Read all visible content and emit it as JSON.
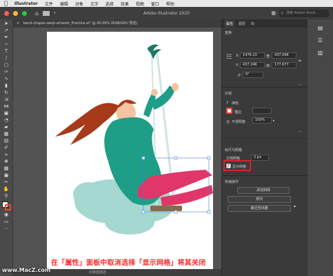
{
  "menubar": {
    "apple": "",
    "app": "Illustrator",
    "items": [
      "文件",
      "编辑",
      "对象",
      "文字",
      "选择",
      "效果",
      "视图",
      "窗口",
      "帮助"
    ]
  },
  "appbar": {
    "title": "Adobe Illustrator 2020",
    "search_placeholder": "搜索 Adobe Stock"
  },
  "document": {
    "tab_label": "bend-shapes-warp-artwork_Practice.ai* @ 45.08% (RGB/GPU 预览)",
    "close": "×"
  },
  "statusbar": {
    "text": "切换直接选"
  },
  "panel": {
    "tabs": [
      "属性",
      "图层",
      "库"
    ],
    "transform_title": "变换",
    "x_label": "X:",
    "x_value": "1476.23",
    "w_label": "宽:",
    "w_value": "437.096",
    "y_label": "Y:",
    "y_value": "437.246",
    "h_label": "高:",
    "h_value": "177.677",
    "angle_value": "0°",
    "appearance_title": "外观",
    "fill_label": "填色",
    "stroke_label": "描边",
    "stroke_value": "",
    "opacity_label": "不透明度",
    "opacity_value": "100%",
    "ruler_title": "标尺与网格",
    "grid_spacing_label": "文档网格",
    "grid_spacing_value": "2 px",
    "show_grid_label": "显示网格",
    "quick_actions_title": "快速操作",
    "btn_expand": "添加到库",
    "btn_arrange": "排列",
    "btn_path": "路径查找器",
    "more": "..."
  },
  "caption": "在「属性」面板中取消选择「显示网格」将其关闭",
  "watermark": "www.MacZ.com",
  "colors": {
    "hair": "#a63a1a",
    "sweater": "#1e9e86",
    "pants": "#e0366a",
    "cloud": "#a5d8d0",
    "bird": "#1a7a63",
    "highlight": "#e0202a"
  },
  "icons": {
    "tools": [
      "selection-tool-icon",
      "direct-selection-tool-icon",
      "pen-tool-icon",
      "curvature-tool-icon",
      "type-tool-icon",
      "line-tool-icon",
      "rectangle-tool-icon",
      "paintbrush-tool-icon",
      "shaper-tool-icon",
      "eraser-tool-icon",
      "rotate-tool-icon",
      "scale-tool-icon",
      "width-tool-icon",
      "free-transform-tool-icon",
      "shape-builder-tool-icon",
      "perspective-tool-icon",
      "mesh-tool-icon",
      "gradient-tool-icon",
      "eyedropper-tool-icon",
      "blend-tool-icon",
      "symbol-sprayer-tool-icon",
      "graph-tool-icon",
      "artboard-tool-icon",
      "slice-tool-icon",
      "hand-tool-icon",
      "zoom-tool-icon"
    ]
  }
}
